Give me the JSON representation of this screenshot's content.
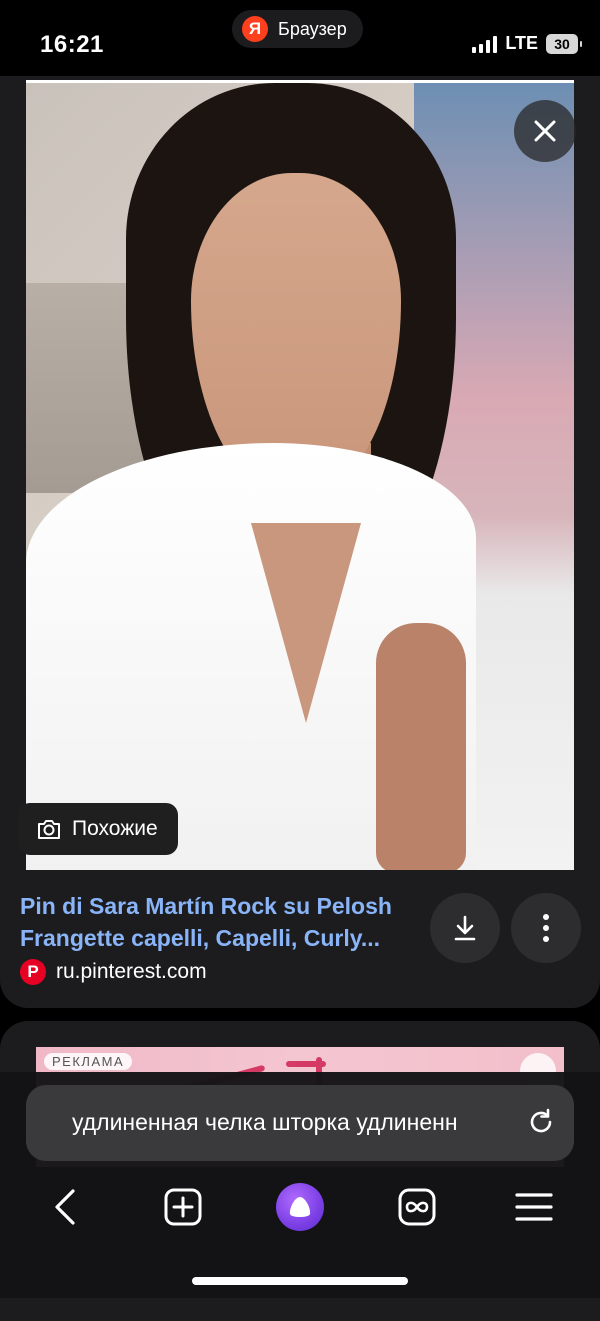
{
  "status_bar": {
    "time": "16:21",
    "app_name": "Браузер",
    "app_logo_letter": "Я",
    "network": "LTE",
    "battery": "30"
  },
  "result": {
    "image_subject": "woman-selfie-white-shirt",
    "similar_label": "Похожие",
    "title": "Pin di Sara Martín Rock su Pelosh Frangette capelli, Capelli, Curly...",
    "source": "ru.pinterest.com",
    "source_icon_letter": "P",
    "colors": {
      "title": "#8ab4f8",
      "card_bg": "#1c1c1e",
      "pinterest": "#e60023"
    }
  },
  "ad": {
    "badge": "РЕКЛАМА"
  },
  "search": {
    "query": "удлиненная челка шторка удлиненн"
  },
  "nav": {
    "items": [
      "back-icon",
      "new-tab-icon",
      "alice-icon",
      "tabs-icon",
      "menu-icon"
    ],
    "accent": "#7b3fe4"
  }
}
